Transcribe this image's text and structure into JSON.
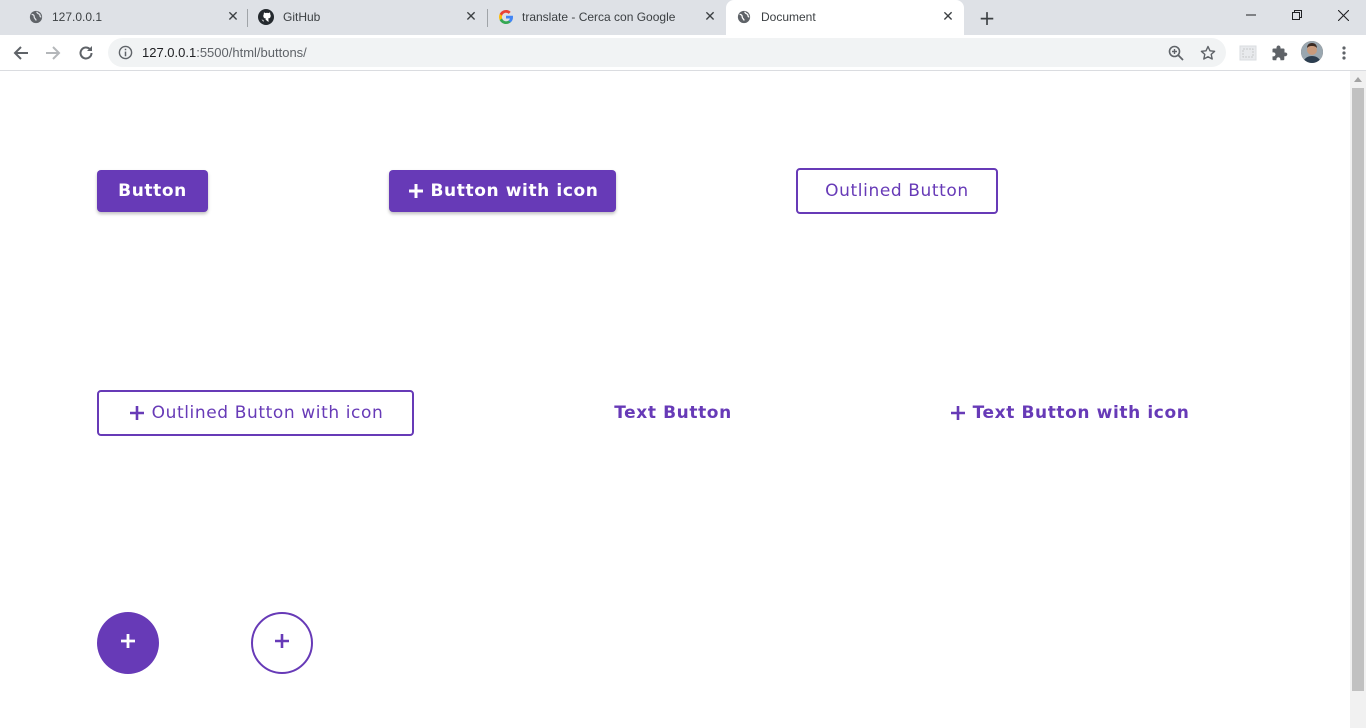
{
  "tabs": [
    {
      "title": "127.0.0.1",
      "icon": "globe-icon"
    },
    {
      "title": "GitHub",
      "icon": "github-icon"
    },
    {
      "title": "translate - Cerca con Google",
      "icon": "google-icon"
    },
    {
      "title": "Document",
      "icon": "globe-icon",
      "active": true
    }
  ],
  "address_bar": {
    "host": "127.0.0.1",
    "path": ":5500/html/buttons/"
  },
  "colors": {
    "accent": "#673ab7",
    "tabstrip": "#dee1e6"
  },
  "buttons": {
    "contained": "Button",
    "contained_icon": "Button with icon",
    "outlined": "Outlined Button",
    "outlined_icon": "Outlined Button with icon",
    "text": "Text Button",
    "text_icon": "Text Button with icon"
  },
  "fabs": [
    {
      "style": "filled",
      "icon": "plus-icon"
    },
    {
      "style": "outlined",
      "icon": "plus-icon"
    }
  ]
}
